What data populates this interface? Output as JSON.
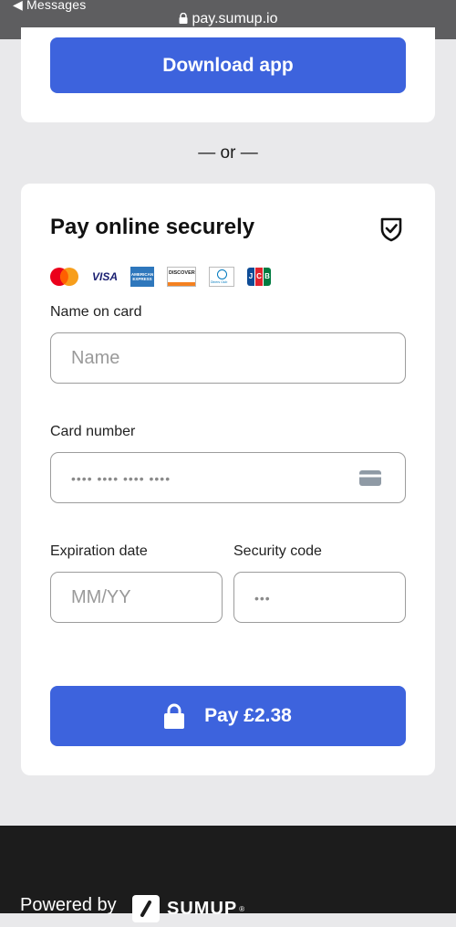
{
  "statusbar": {
    "back_label": "◀ Messages",
    "url": "pay.sumup.io"
  },
  "top_card": {
    "download_label": "Download app"
  },
  "separator": "— or —",
  "pay_card": {
    "title": "Pay online securely",
    "card_brands": {
      "visa": "VISA",
      "amex": "AMERICAN EXPRESS",
      "discover": "DISCOVER",
      "diners": "Diners Club",
      "jcb": "JCB"
    },
    "name_label": "Name on card",
    "name_placeholder": "Name",
    "card_number_label": "Card number",
    "card_number_placeholder": "•••• •••• •••• ••••",
    "expiry_label": "Expiration date",
    "expiry_placeholder": "MM/YY",
    "security_label": "Security code",
    "security_placeholder": "•••",
    "pay_label": "Pay £2.38"
  },
  "footer": {
    "powered_by": "Powered by",
    "brand": "SUMUP",
    "brand_mark": "®"
  },
  "colors": {
    "accent": "#3d63dd",
    "footer_bg": "#1c1c1c",
    "page_bg": "#e9e9eb"
  }
}
